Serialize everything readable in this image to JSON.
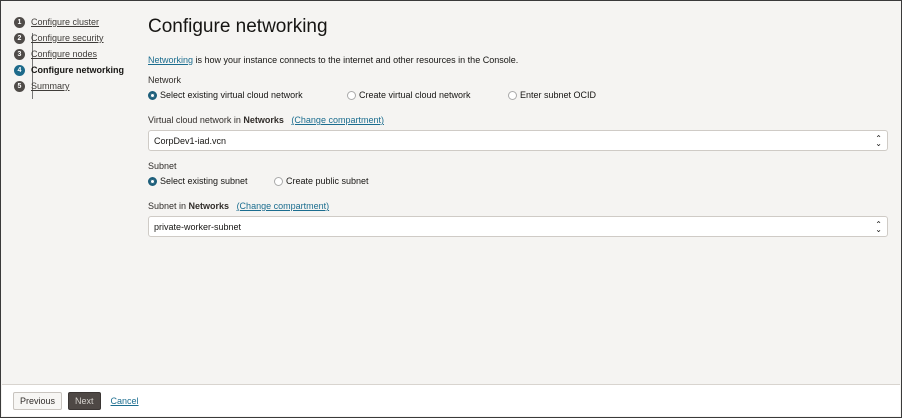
{
  "steps": [
    {
      "num": "1",
      "label": "Configure cluster"
    },
    {
      "num": "2",
      "label": "Configure security"
    },
    {
      "num": "3",
      "label": "Configure nodes"
    },
    {
      "num": "4",
      "label": "Configure networking"
    },
    {
      "num": "5",
      "label": "Summary"
    }
  ],
  "title": "Configure networking",
  "intro": {
    "link": "Networking",
    "text": " is how your instance connects to the internet and other resources in the Console."
  },
  "network": {
    "label": "Network",
    "options": [
      "Select existing virtual cloud network",
      "Create virtual cloud network",
      "Enter subnet OCID"
    ],
    "selected": 0
  },
  "vcn": {
    "label": "Virtual cloud network in ",
    "compartment": "Networks",
    "change": "(Change compartment)",
    "value": "CorpDev1-iad.vcn"
  },
  "subnet": {
    "label": "Subnet",
    "options": [
      "Select existing subnet",
      "Create public subnet"
    ],
    "selected": 0
  },
  "subnet_select": {
    "label": "Subnet in ",
    "compartment": "Networks",
    "change": "(Change compartment)",
    "value": "private-worker-subnet"
  },
  "footer": {
    "previous": "Previous",
    "next": "Next",
    "cancel": "Cancel"
  }
}
